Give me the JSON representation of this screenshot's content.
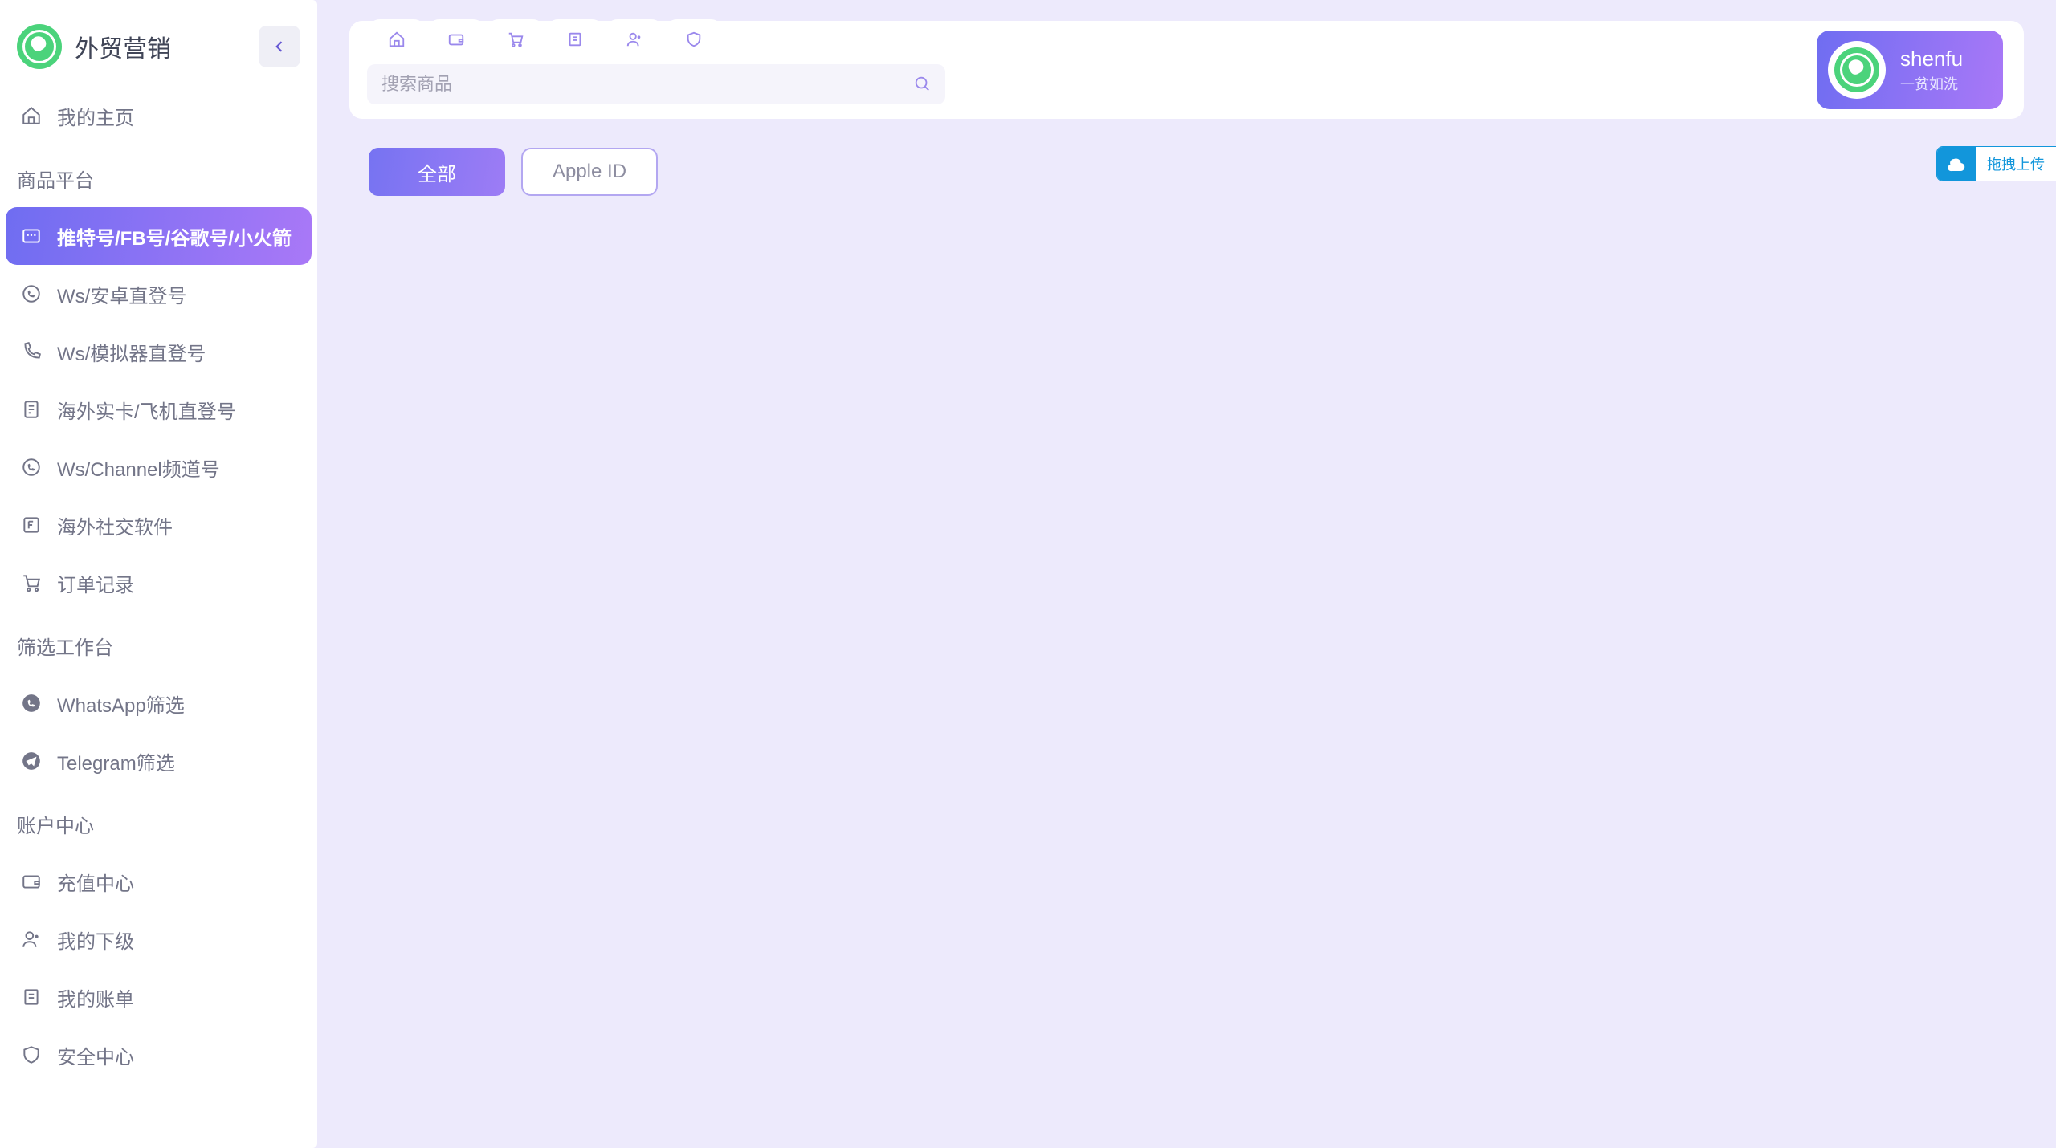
{
  "brand": {
    "title": "外贸营销"
  },
  "sidebar": {
    "my_home": "我的主页",
    "section_products": "商品平台",
    "items_products": [
      {
        "label": "推特号/FB号/谷歌号/小火箭",
        "icon": "chat-icon",
        "active": true
      },
      {
        "label": "Ws/安卓直登号",
        "icon": "whatsapp-icon",
        "active": false
      },
      {
        "label": "Ws/模拟器直登号",
        "icon": "phone-icon",
        "active": false
      },
      {
        "label": "海外实卡/飞机直登号",
        "icon": "sim-icon",
        "active": false
      },
      {
        "label": "Ws/Channel频道号",
        "icon": "whatsapp-icon",
        "active": false
      },
      {
        "label": "海外社交软件",
        "icon": "box-f-icon",
        "active": false
      },
      {
        "label": "订单记录",
        "icon": "cart-icon",
        "active": false
      }
    ],
    "section_filter": "筛选工作台",
    "items_filter": [
      {
        "label": "WhatsApp筛选",
        "icon": "whatsapp-solid-icon"
      },
      {
        "label": "Telegram筛选",
        "icon": "telegram-icon"
      }
    ],
    "section_account": "账户中心",
    "items_account": [
      {
        "label": "充值中心",
        "icon": "wallet-icon"
      },
      {
        "label": "我的下级",
        "icon": "users-icon"
      },
      {
        "label": "我的账单",
        "icon": "receipt-icon"
      },
      {
        "label": "安全中心",
        "icon": "shield-icon"
      }
    ]
  },
  "top_tabs": [
    {
      "icon": "home-icon"
    },
    {
      "icon": "wallet-icon"
    },
    {
      "icon": "cart-icon"
    },
    {
      "icon": "receipt-icon"
    },
    {
      "icon": "users-icon"
    },
    {
      "icon": "shield-icon"
    }
  ],
  "search": {
    "placeholder": "搜索商品"
  },
  "user": {
    "name": "shenfu",
    "subtitle": "一贫如洗"
  },
  "filters": [
    {
      "label": "全部",
      "active": true
    },
    {
      "label": "Apple ID",
      "active": false
    }
  ],
  "upload": {
    "label": "拖拽上传"
  }
}
